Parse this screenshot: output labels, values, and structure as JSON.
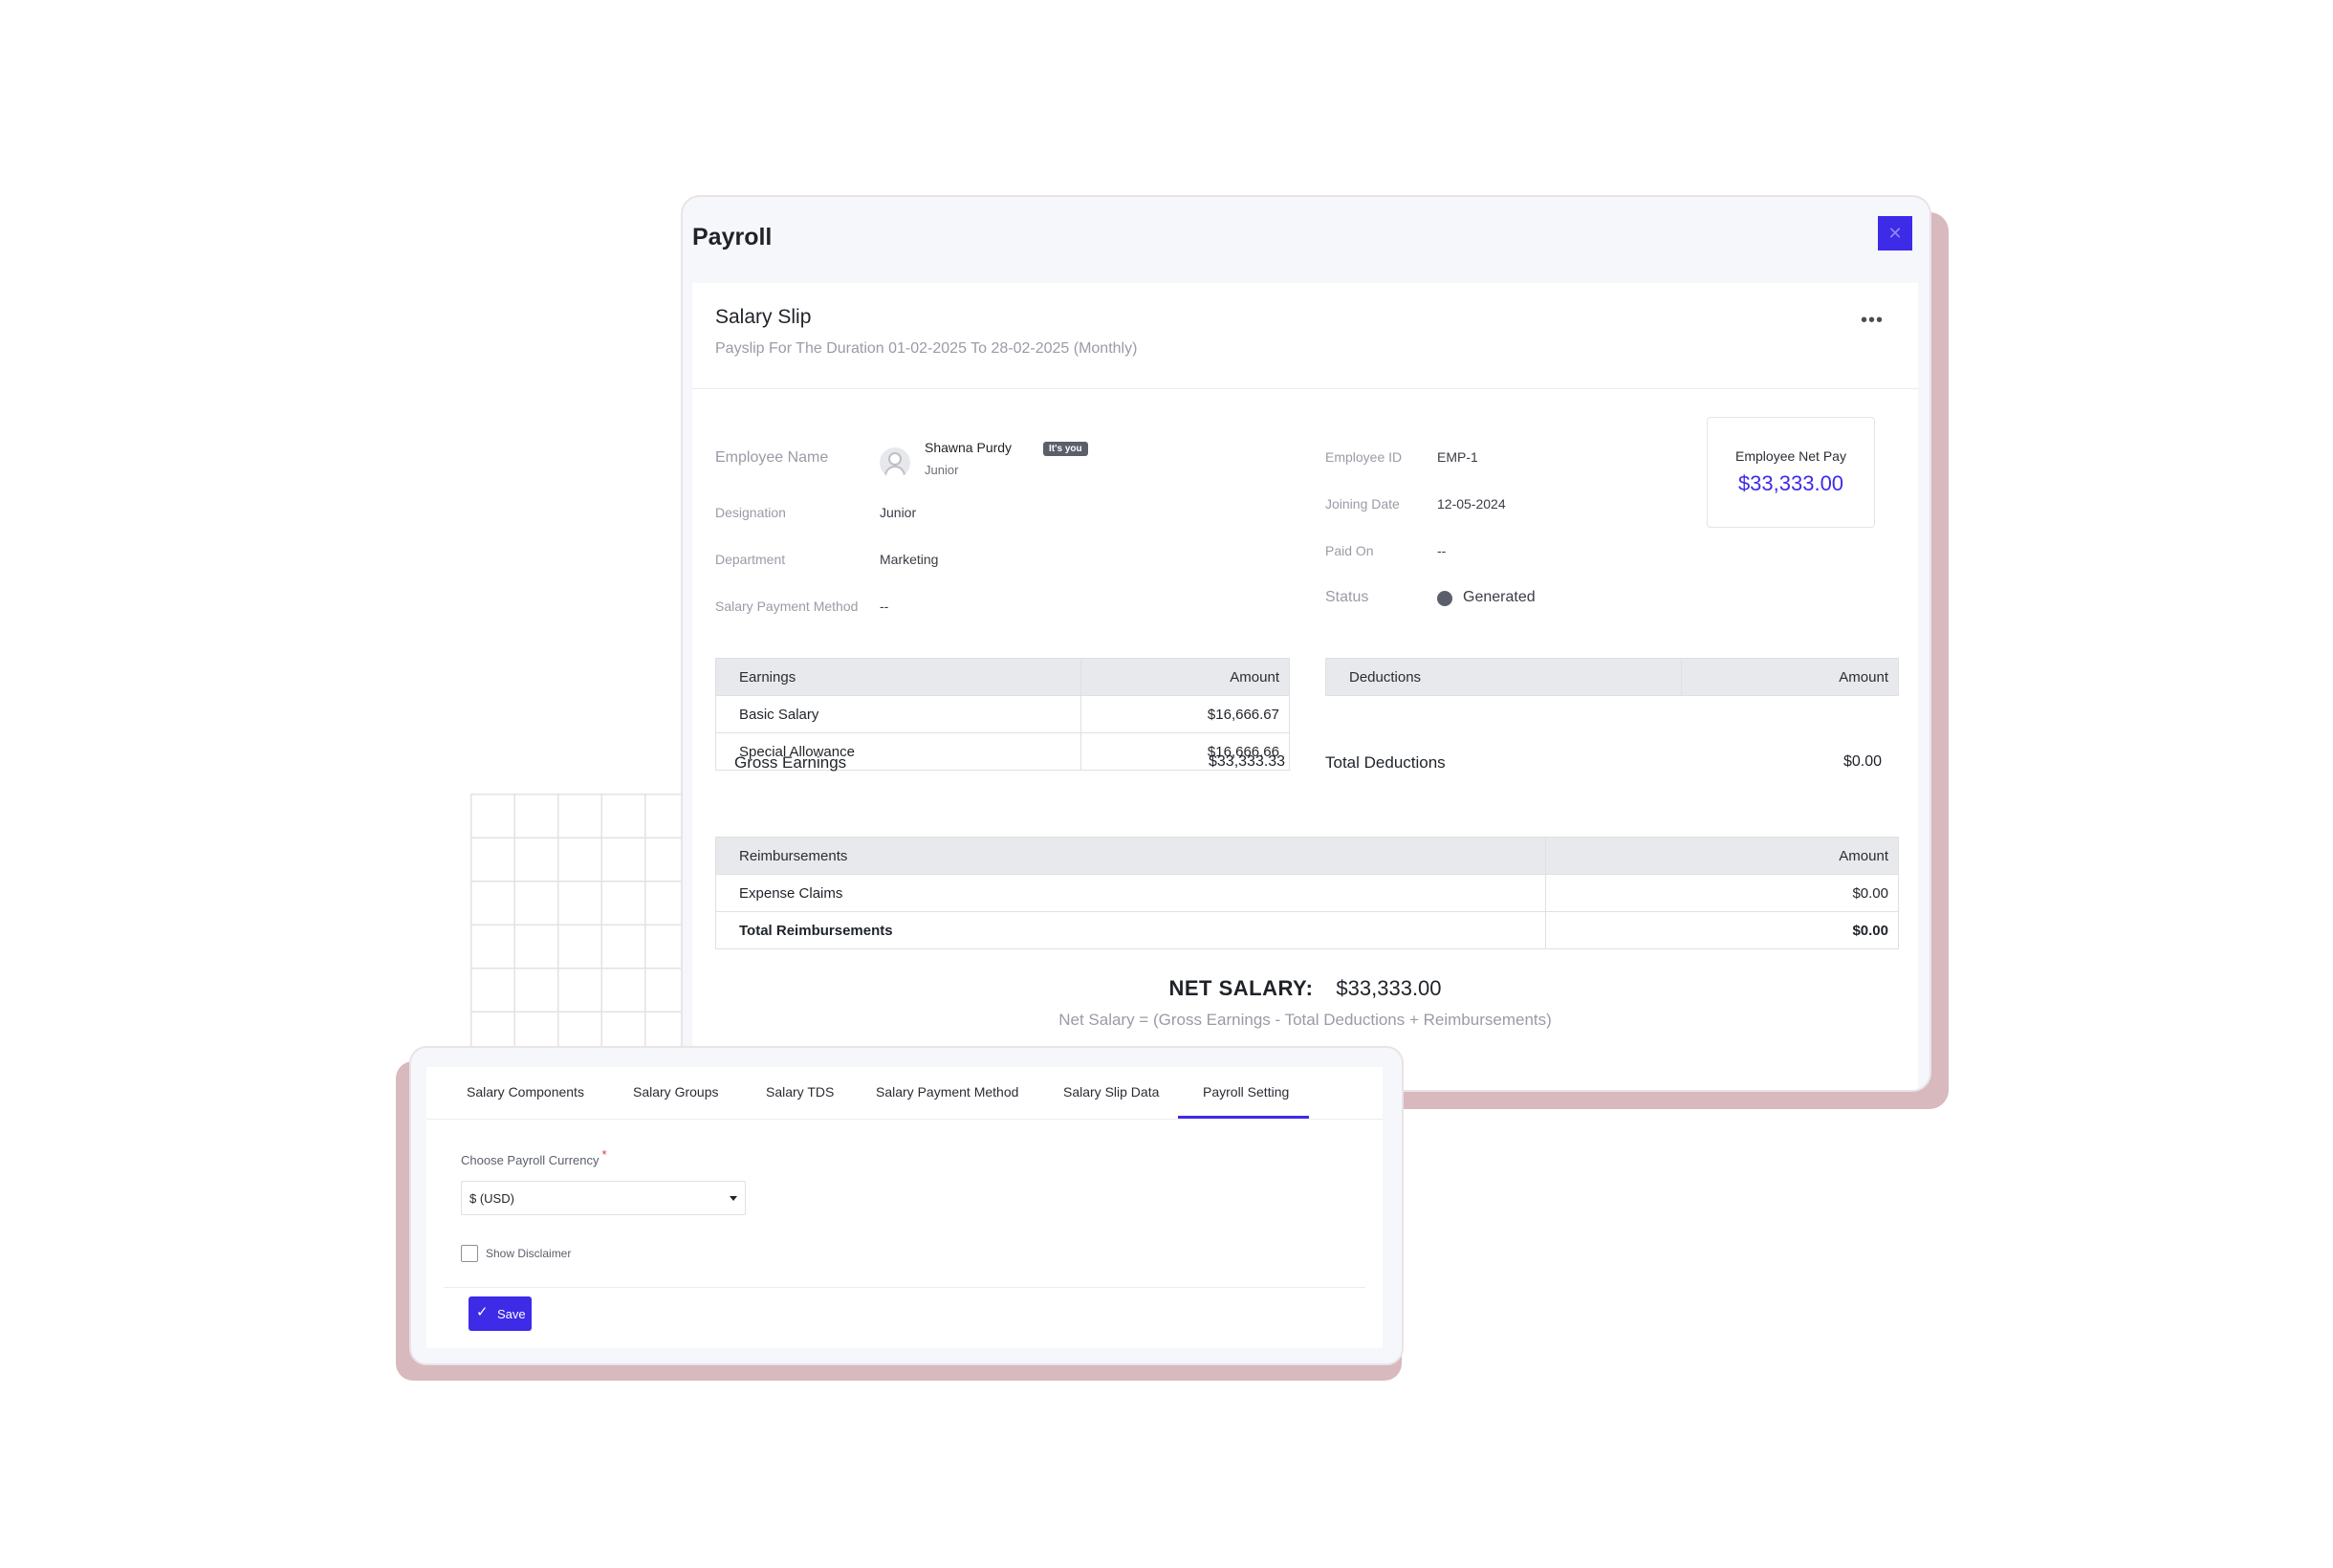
{
  "window": {
    "title": "Payroll",
    "close_icon": "✕"
  },
  "slip": {
    "title": "Salary Slip",
    "subtitle": "Payslip For The Duration 01-02-2025 To 28-02-2025 (Monthly)",
    "more_icon": "•••"
  },
  "employee": {
    "name_label": "Employee Name",
    "name": "Shawna Purdy",
    "badge": "It's you",
    "role": "Junior",
    "designation_label": "Designation",
    "designation": "Junior",
    "department_label": "Department",
    "department": "Marketing",
    "payment_method_label": "Salary Payment Method",
    "payment_method": "--",
    "id_label": "Employee ID",
    "id": "EMP-1",
    "joining_label": "Joining Date",
    "joining_date": "12-05-2024",
    "paid_on_label": "Paid On",
    "paid_on": "--",
    "status_label": "Status",
    "status": "Generated",
    "status_color": "#5b5f6a"
  },
  "net_pay_box": {
    "label": "Employee Net Pay",
    "value": "$33,333.00",
    "accent": "#3d2be8"
  },
  "earnings": {
    "headers": [
      "Earnings",
      "Amount"
    ],
    "rows": [
      {
        "name": "Basic Salary",
        "amount": "$16,666.67"
      },
      {
        "name": "Special Allowance",
        "amount": "$16,666.66"
      }
    ],
    "total_label": "Gross Earnings",
    "total": "$33,333.33"
  },
  "deductions": {
    "headers": [
      "Deductions",
      "Amount"
    ],
    "total_label": "Total Deductions",
    "total": "$0.00"
  },
  "reimbursements": {
    "headers": [
      "Reimbursements",
      "Amount"
    ],
    "rows": [
      {
        "name": "Expense Claims",
        "amount": "$0.00"
      }
    ],
    "total_label": "Total Reimbursements",
    "total": "$0.00"
  },
  "net_salary": {
    "label": "NET SALARY:",
    "value": "$33,333.00",
    "formula": "Net Salary = (Gross Earnings - Total Deductions + Reimbursements)"
  },
  "settings": {
    "tabs": [
      "Salary Components",
      "Salary Groups",
      "Salary TDS",
      "Salary Payment Method",
      "Salary Slip Data",
      "Payroll Setting"
    ],
    "active_tab": "Payroll Setting",
    "currency_label": "Choose Payroll Currency",
    "required_mark": "*",
    "currency_value": "$ (USD)",
    "disclaimer_label": "Show Disclaimer",
    "disclaimer_checked": false,
    "save_label": "Save",
    "save_icon": "✓"
  }
}
